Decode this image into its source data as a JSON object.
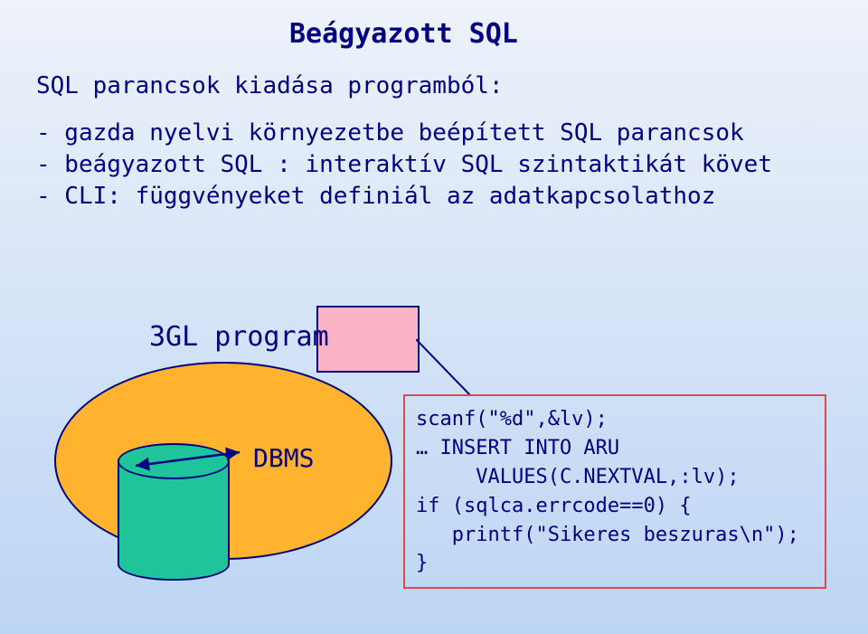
{
  "title": "Beágyazott SQL",
  "intro": "SQL parancsok kiadása programból:",
  "bullets": {
    "b1": "- gazda nyelvi környezetbe beépített SQL parancsok",
    "b2": "- beágyazott SQL : interaktív SQL szintaktikát követ",
    "b3": "- CLI: függvényeket definiál az adatkapcsolathoz"
  },
  "labels": {
    "gl": "3GL program",
    "dbms": "DBMS"
  },
  "code": {
    "l1": "scanf(\"%d\",&lv);",
    "l2": "… INSERT INTO ARU",
    "l3": "     VALUES(C.NEXTVAL,:lv);",
    "l4": "if (sqlca.errcode==0) {",
    "l5": "   printf(\"Sikeres beszuras\\n\");",
    "l6": "}"
  }
}
